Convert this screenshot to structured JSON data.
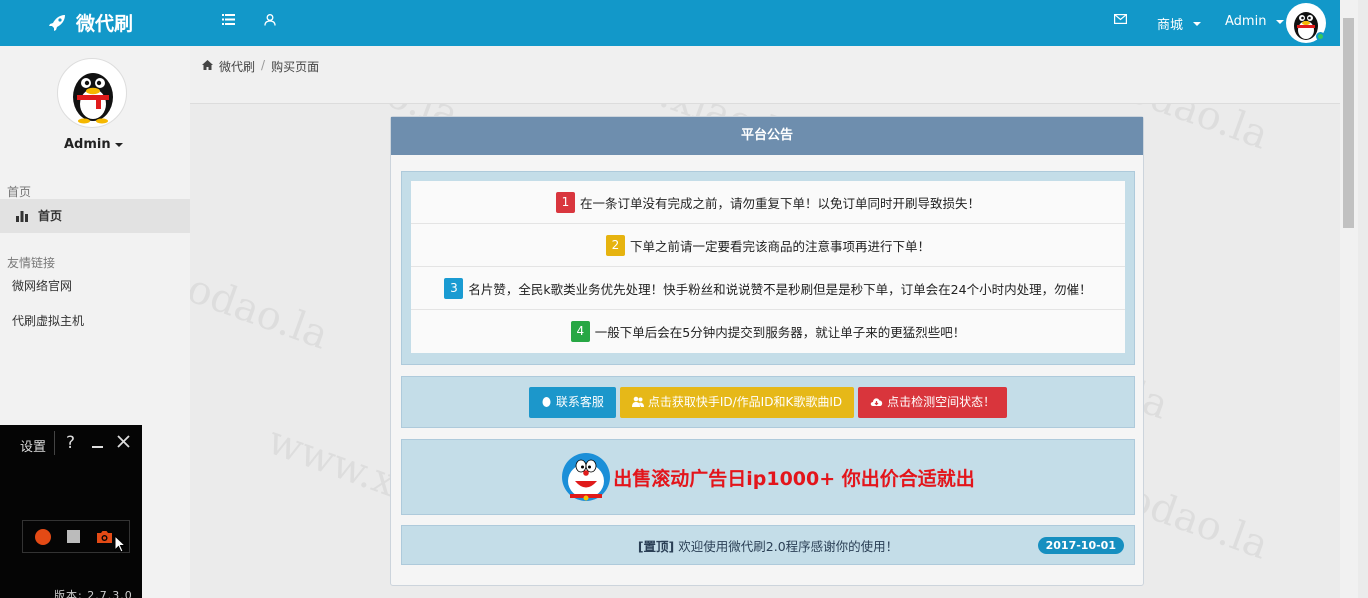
{
  "brand": {
    "name": "微代刷"
  },
  "topbar": {
    "city_label": "商城",
    "admin_label": "Admin"
  },
  "sidebar": {
    "username": "Admin",
    "sections": [
      {
        "title": "首页",
        "items": [
          {
            "label": "首页",
            "active": true
          }
        ]
      },
      {
        "title": "友情链接",
        "items": [
          {
            "label": "微网络官网"
          },
          {
            "label": "代刷虚拟主机"
          }
        ]
      }
    ]
  },
  "breadcrumb": {
    "home": "微代刷",
    "separator": "/",
    "current": "购买页面"
  },
  "announcement": {
    "title": "平台公告",
    "items": [
      {
        "num": "1",
        "text": "在一条订单没有完成之前，请勿重复下单！以免订单同时开刷导致损失！",
        "color": "#d9363e"
      },
      {
        "num": "2",
        "text": "下单之前请一定要看完该商品的注意事项再进行下单！",
        "color": "#e6b30f"
      },
      {
        "num": "3",
        "text": "名片赞，全民k歌类业务优先处理！快手粉丝和说说赞不是秒刷但是是秒下单，订单会在24个小时内处理，勿催！",
        "color": "#1a9bd2"
      },
      {
        "num": "4",
        "text": "一般下单后会在5分钟内提交到服务器，就让单子来的更猛烈些吧！",
        "color": "#27a744"
      }
    ]
  },
  "buttons": [
    {
      "label": "联系客服",
      "color": "#1c97cb"
    },
    {
      "label": "点击获取快手ID/作品ID和K歌歌曲ID",
      "color": "#e6b818"
    },
    {
      "label": "点击检测空间状态！",
      "color": "#d9353c"
    }
  ],
  "ad": {
    "text": "出售滚动广告日ip1000+ 你出价合适就出"
  },
  "pinned": {
    "tag": "[置顶]",
    "text": "欢迎使用微代刷2.0程序感谢你的使用！",
    "date": "2017-10-01"
  },
  "recorder": {
    "settings": "设置",
    "help": "?",
    "version": "版本: 2.7.3.0"
  },
  "watermark": "www.xiaodao.la"
}
